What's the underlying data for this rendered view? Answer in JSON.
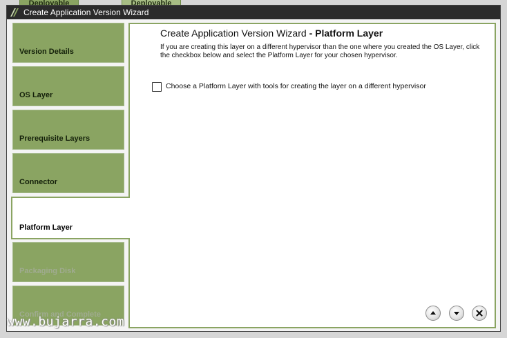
{
  "background_tabs": [
    "Deployable",
    "Deployable"
  ],
  "window": {
    "title": "Create Application Version Wizard"
  },
  "steps": [
    {
      "label": "Version Details",
      "state": "done"
    },
    {
      "label": "OS Layer",
      "state": "done"
    },
    {
      "label": "Prerequisite Layers",
      "state": "done"
    },
    {
      "label": "Connector",
      "state": "done"
    },
    {
      "label": "Platform Layer",
      "state": "active"
    },
    {
      "label": "Packaging Disk",
      "state": "disabled"
    },
    {
      "label": "Confirm and Complete",
      "state": "disabled"
    }
  ],
  "content": {
    "heading_prefix": "Create Application Version Wizard",
    "heading_bold": "- Platform Layer",
    "description": "If you are creating this layer on a different hypervisor than the one where you created the OS Layer, click the checkbox below and select the Platform Layer for your chosen hypervisor.",
    "checkbox_label": "Choose a Platform Layer with tools for creating the layer on a different hypervisor",
    "checkbox_checked": false
  },
  "nav_buttons": {
    "up_icon": "arrow-up-icon",
    "down_icon": "arrow-down-icon",
    "close_icon": "close-icon"
  },
  "watermark": "www.bujarra.com",
  "colors": {
    "accent_green": "#8aa462",
    "titlebar": "#2b2b2b"
  }
}
